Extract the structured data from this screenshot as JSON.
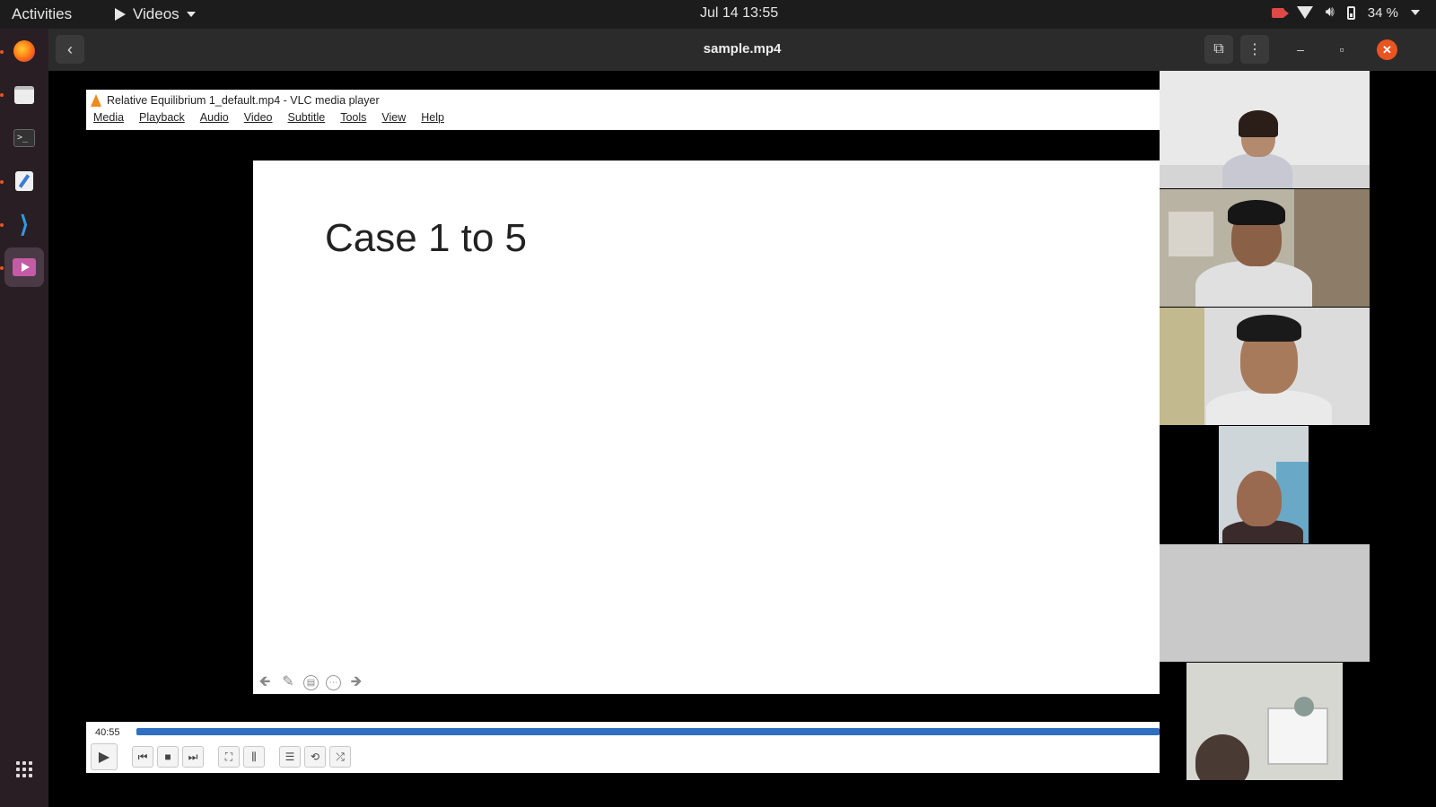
{
  "topbar": {
    "activities": "Activities",
    "app_name": "Videos",
    "clock": "Jul 14  13:55",
    "battery": "34 %"
  },
  "dock": {
    "items": [
      "firefox-icon",
      "files-icon",
      "terminal-icon",
      "text-editor-icon",
      "vscode-icon",
      "videos-icon",
      "app-grid-icon"
    ]
  },
  "player": {
    "title": "sample.mp4"
  },
  "vlc": {
    "window_title": "Relative Equilibrium 1_default.mp4 - VLC media player",
    "menu": [
      "Media",
      "Playback",
      "Audio",
      "Video",
      "Subtitle",
      "Tools",
      "View",
      "Help"
    ],
    "time": "40:55",
    "progress": 1.0
  },
  "slide": {
    "title": "Case 1 to 5"
  },
  "participants": {
    "count": 6
  },
  "colors": {
    "accent": "#e95420",
    "seek": "#2f6fc1",
    "dock": "#2a1e25"
  }
}
